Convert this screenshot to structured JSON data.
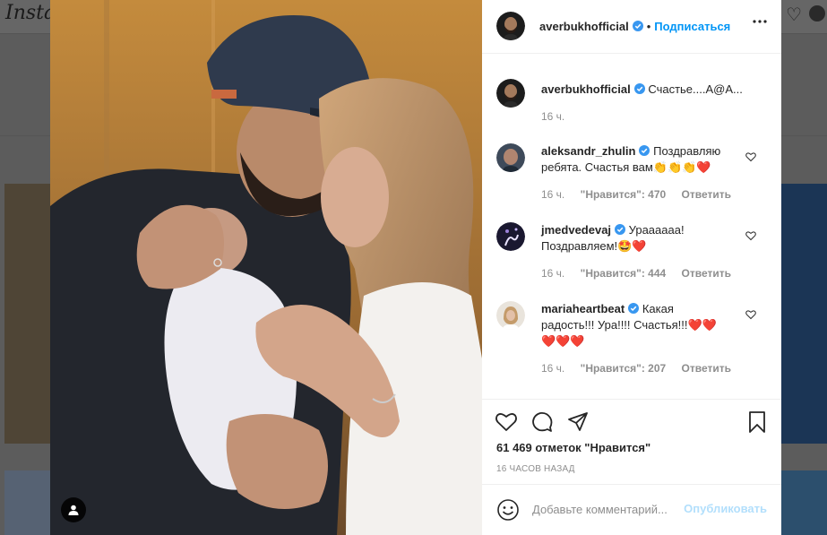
{
  "background": {
    "logo_text": "Insta"
  },
  "post": {
    "author": "averbukhofficial",
    "follow_label": "Подписаться",
    "caption_author": "averbukhofficial",
    "caption_text": "Счастье....А@А...",
    "caption_time": "16 ч.",
    "likes": "61 469 отметок \"Нравится\"",
    "time_ago": "16 ЧАСОВ НАЗАД"
  },
  "comments": [
    {
      "username": "aleksandr_zhulin",
      "verified": true,
      "text_line1": "Поздравляю",
      "text_line2": "ребята. Счастья вам👏👏👏❤️",
      "time": "16 ч.",
      "likes": "\"Нравится\": 470",
      "reply": "Ответить"
    },
    {
      "username": "jmedvedevaj",
      "verified": true,
      "text_line1": "Ураааааа!",
      "text_line2": "Поздравляем!🤩❤️",
      "time": "16 ч.",
      "likes": "\"Нравится\": 444",
      "reply": "Ответить"
    },
    {
      "username": "mariaheartbeat",
      "verified": true,
      "text_line1": "Какая",
      "text_line2": "радость!!! Ура!!!! Счастья!!!❤️❤️",
      "text_line3": "❤️❤️❤️",
      "time": "16 ч.",
      "likes": "\"Нравится\": 207",
      "reply": "Ответить"
    }
  ],
  "add_comment": {
    "placeholder": "Добавьте комментарий...",
    "post_label": "Опубликовать"
  },
  "colors": {
    "accent": "#0095f6",
    "verified": "#3897f0",
    "muted": "#8e8e8e",
    "post_disabled": "#b2dffc"
  }
}
